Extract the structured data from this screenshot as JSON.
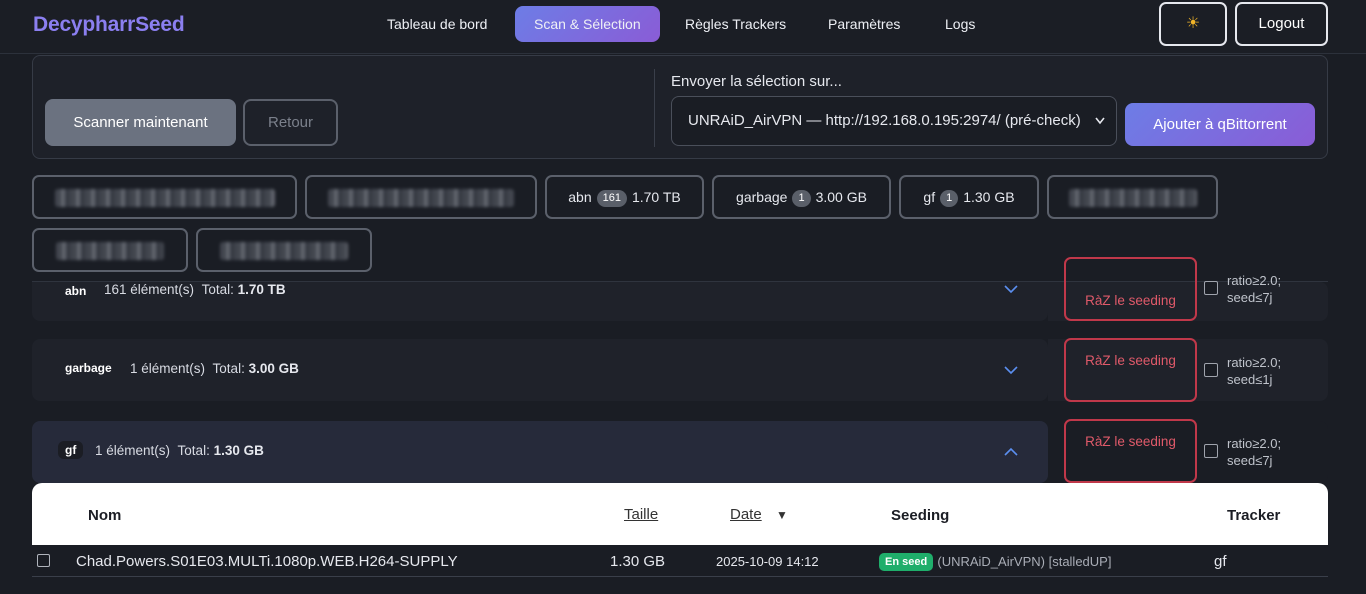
{
  "brand": "DecypharrSeed",
  "nav": {
    "items": [
      {
        "label": "Tableau de bord"
      },
      {
        "label": "Scan & Sélection"
      },
      {
        "label": "Règles Trackers"
      },
      {
        "label": "Paramètres"
      },
      {
        "label": "Logs"
      }
    ],
    "active": "Scan & Sélection",
    "theme_icon": "sun-icon",
    "logout_label": "Logout"
  },
  "controls": {
    "scan_label": "Scanner maintenant",
    "back_label": "Retour",
    "send_label": "Envoyer la sélection sur...",
    "send_target": "UNRAiD_AirVPN — http://192.168.0.195:2974/ (pré-check)",
    "add_label": "Ajouter à qBittorrent"
  },
  "chips": [
    {
      "name": "abn",
      "count": "161",
      "size": "1.70 TB"
    },
    {
      "name": "garbage",
      "count": "1",
      "size": "3.00 GB"
    },
    {
      "name": "gf",
      "count": "1",
      "size": "1.30 GB"
    }
  ],
  "groups": [
    {
      "tag": "abn",
      "count_text": "161 élément(s)",
      "total_label": "Total:",
      "total": "1.70 TB",
      "reset": "RàZ le seeding",
      "rule_line1": "ratio≥2.0;",
      "rule_line2": "seed≤7j"
    },
    {
      "tag": "garbage",
      "count_text": "1 élément(s)",
      "total_label": "Total:",
      "total": "3.00 GB",
      "reset": "RàZ le seeding",
      "rule_line1": "ratio≥2.0;",
      "rule_line2": "seed≤1j"
    },
    {
      "tag": "gf",
      "count_text": "1 élément(s)",
      "total_label": "Total:",
      "total": "1.30 GB",
      "reset": "RàZ le seeding",
      "rule_line1": "ratio≥2.0;",
      "rule_line2": "seed≤7j"
    }
  ],
  "table": {
    "headers": {
      "name": "Nom",
      "size": "Taille",
      "date": "Date",
      "seeding": "Seeding",
      "tracker": "Tracker"
    },
    "rows": [
      {
        "name": "Chad.Powers.S01E03.MULTi.1080p.WEB.H264-SUPPLY",
        "size": "1.30 GB",
        "date": "2025-10-09 14:12",
        "seed_badge": "En seed",
        "seed_info": "(UNRAiD_AirVPN) [stalledUP]",
        "tracker": "gf"
      }
    ]
  },
  "colors": {
    "accent": "#7c6fe8",
    "danger": "#c0384a",
    "success": "#1fae6b"
  }
}
